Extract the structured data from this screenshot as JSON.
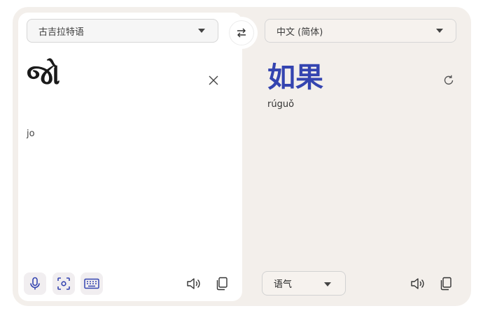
{
  "source": {
    "language": "古吉拉特语",
    "text": "જો",
    "transliteration": "jo"
  },
  "target": {
    "language": "中文 (简体)",
    "text": "如果",
    "transliteration": "rúguǒ",
    "tone_label": "语气"
  },
  "icons": {
    "swap": "swap-icon",
    "clear": "close-icon",
    "refresh": "refresh-icon",
    "mic": "microphone-icon",
    "camera": "camera-scan-icon",
    "keyboard": "keyboard-icon",
    "speaker": "speaker-icon",
    "copy": "copy-icon"
  },
  "colors": {
    "accent": "#3444b0",
    "panel_bg": "#f3efeb"
  }
}
